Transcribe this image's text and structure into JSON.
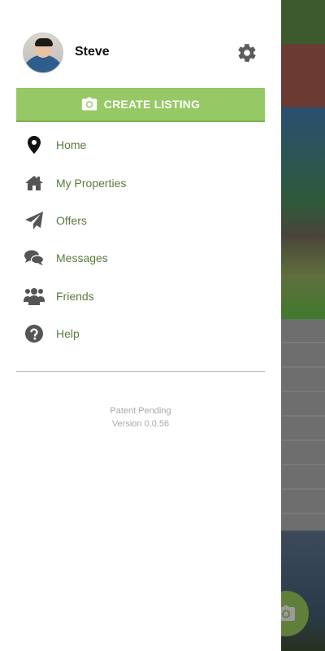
{
  "user": {
    "name": "Steve"
  },
  "actions": {
    "create_listing_label": "CREATE LISTING"
  },
  "menu": {
    "items": [
      {
        "label": "Home",
        "icon": "map-pin-icon"
      },
      {
        "label": "My Properties",
        "icon": "house-icon"
      },
      {
        "label": "Offers",
        "icon": "paper-plane-icon"
      },
      {
        "label": "Messages",
        "icon": "chat-bubbles-icon"
      },
      {
        "label": "Friends",
        "icon": "users-icon"
      },
      {
        "label": "Help",
        "icon": "help-circle-icon"
      }
    ]
  },
  "footer": {
    "line1": "Patent Pending",
    "line2": "Version 0.0.56"
  },
  "colors": {
    "accent": "#96c966",
    "menu_text": "#5a7a3c",
    "icon": "#555555"
  }
}
